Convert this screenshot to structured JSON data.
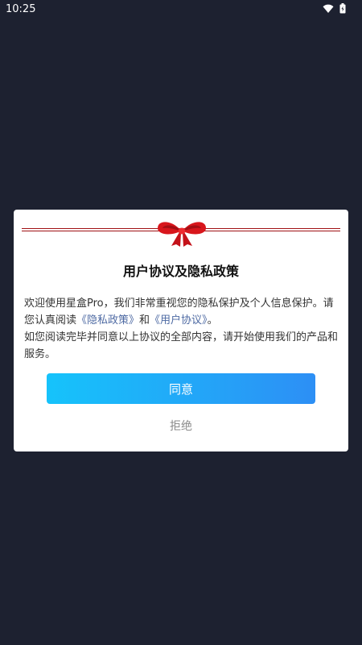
{
  "status_bar": {
    "time": "10:25",
    "icons": [
      "wifi-icon",
      "battery-icon"
    ]
  },
  "dialog": {
    "decoration_icon": "bow-icon",
    "accent_color": "#a01014",
    "title": "用户协议及隐私政策",
    "body": {
      "line1_prefix": "欢迎使用星盒Pro，我们非常重视您的隐私保护及个人信息保护。请您认真阅读",
      "privacy_link": "《隐私政策》",
      "and": "和",
      "user_agreement_link": "《用户协议》",
      "line1_suffix": "。",
      "line2": "如您阅读完毕并同意以上协议的全部内容，请开始使用我们的产品和服务。"
    },
    "agree_label": "同意",
    "reject_label": "拒绝",
    "button_gradient": [
      "#16c3fb",
      "#2d8ff5"
    ],
    "link_color": "#4e6aa3"
  },
  "background_color": "#1d2130"
}
